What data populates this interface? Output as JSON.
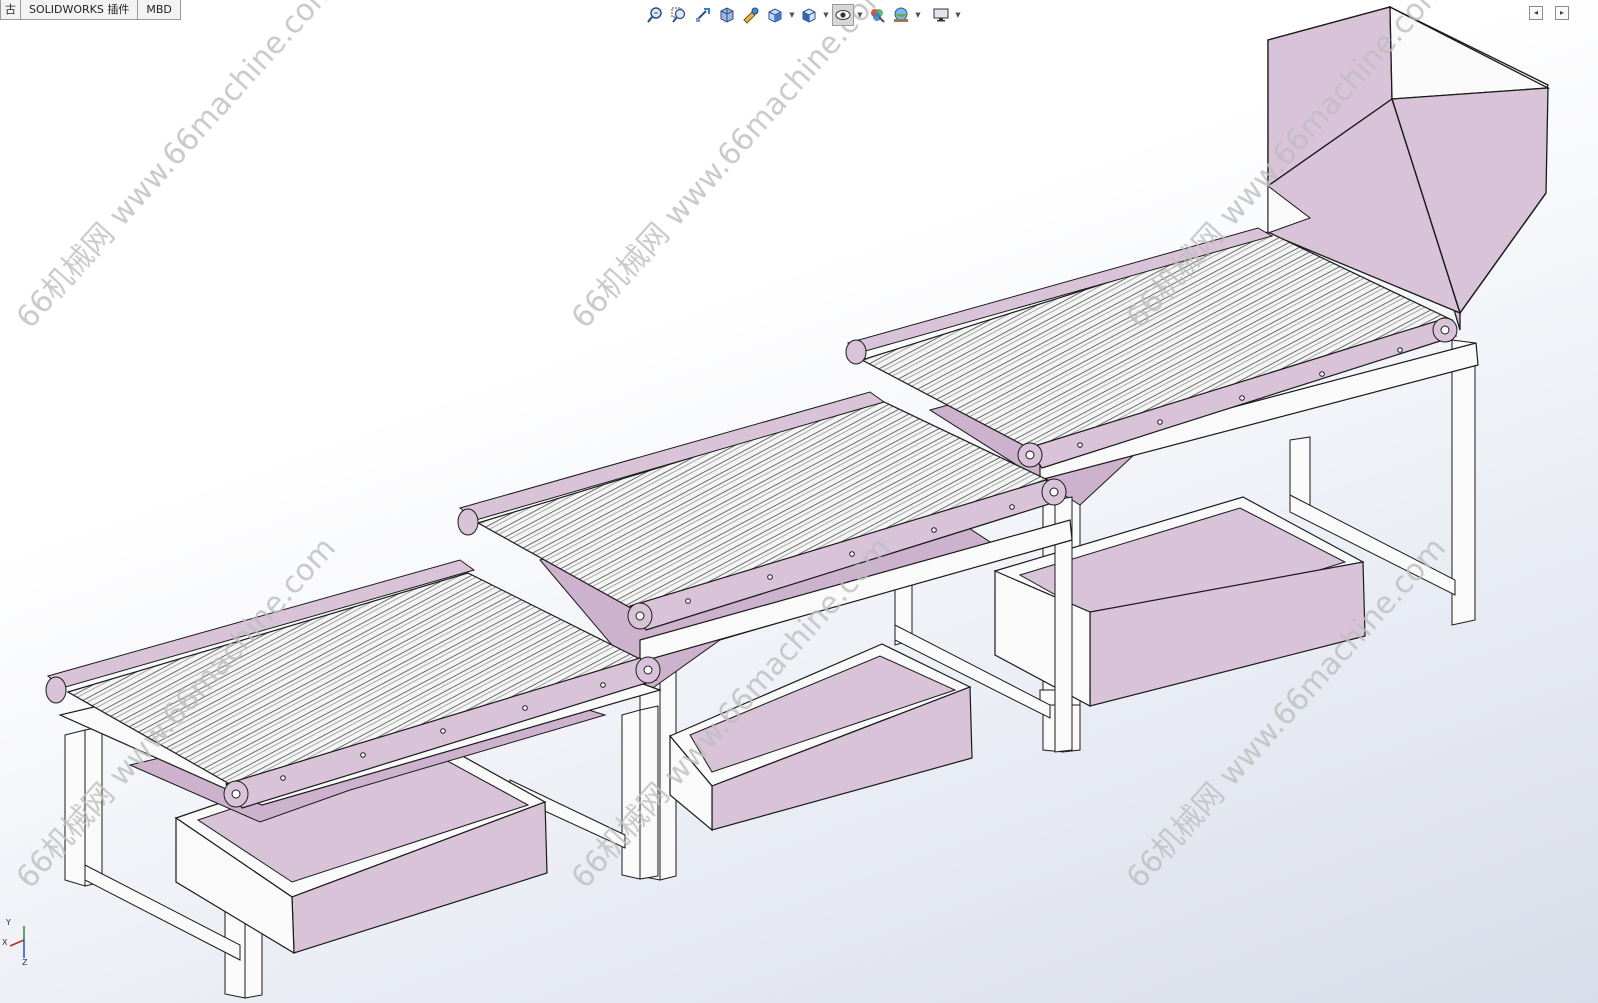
{
  "command_tabs": [
    {
      "label": "古"
    },
    {
      "label": "SOLIDWORKS 插件"
    },
    {
      "label": "MBD"
    }
  ],
  "heads_up_toolbar": {
    "tools": [
      {
        "icon": "zoom-to-fit-icon"
      },
      {
        "icon": "zoom-to-area-icon"
      },
      {
        "icon": "previous-view-icon"
      },
      {
        "icon": "section-view-icon"
      },
      {
        "icon": "dynamic-annotation-icon"
      },
      {
        "icon": "view-orientation-icon"
      },
      {
        "icon": "display-style-icon"
      },
      {
        "icon": "hide-show-items-icon"
      },
      {
        "icon": "edit-appearance-icon"
      },
      {
        "icon": "apply-scene-icon"
      },
      {
        "icon": "view-settings-icon"
      }
    ]
  },
  "watermark": {
    "text": "66机械网 www.66machine.com"
  },
  "triad": {
    "x": "X",
    "y": "Y",
    "z": "Z"
  },
  "colors": {
    "part_fill": "#d9c3d9",
    "part_dark": "#cdb2cd",
    "part_light": "#efe5ef",
    "white_part": "#fafafa",
    "edge": "#1a1a1a",
    "watermark": "#b8b8b8"
  }
}
